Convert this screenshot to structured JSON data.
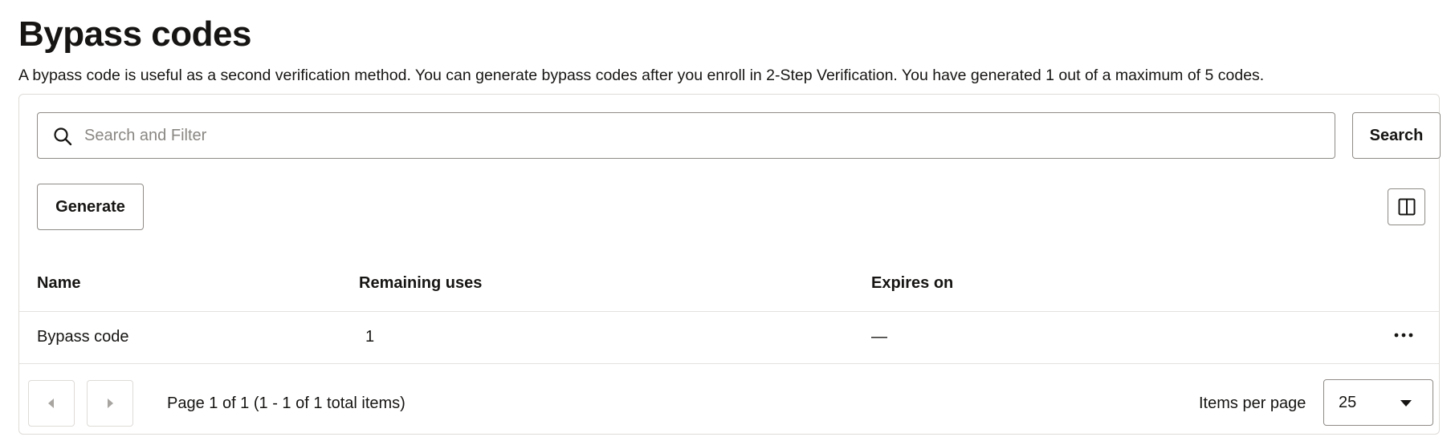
{
  "page": {
    "title": "Bypass codes",
    "description": "A bypass code is useful as a second verification method. You can generate bypass codes after you enroll in 2-Step Verification. You have generated 1 out of a maximum of 5 codes."
  },
  "toolbar": {
    "search_placeholder": "Search and Filter",
    "search_value": "",
    "search_label": "Search",
    "generate_label": "Generate",
    "columns_icon": "columns-icon"
  },
  "table": {
    "columns": [
      "Name",
      "Remaining uses",
      "Expires on"
    ],
    "rows": [
      {
        "name": "Bypass code",
        "remaining_uses": "1",
        "expires_on": "—",
        "actions_icon": "more-horizontal-icon"
      }
    ]
  },
  "pagination": {
    "prev_icon": "chevron-left-icon",
    "next_icon": "chevron-right-icon",
    "page_info": "Page 1 of 1 (1 - 1 of 1 total items)",
    "items_per_page_label": "Items per page",
    "items_per_page_value": "25"
  },
  "colors": {
    "text": "#161513",
    "border": "#8f8b86",
    "divider": "#e4e2df",
    "disabled_icon": "#a8a5a1"
  }
}
